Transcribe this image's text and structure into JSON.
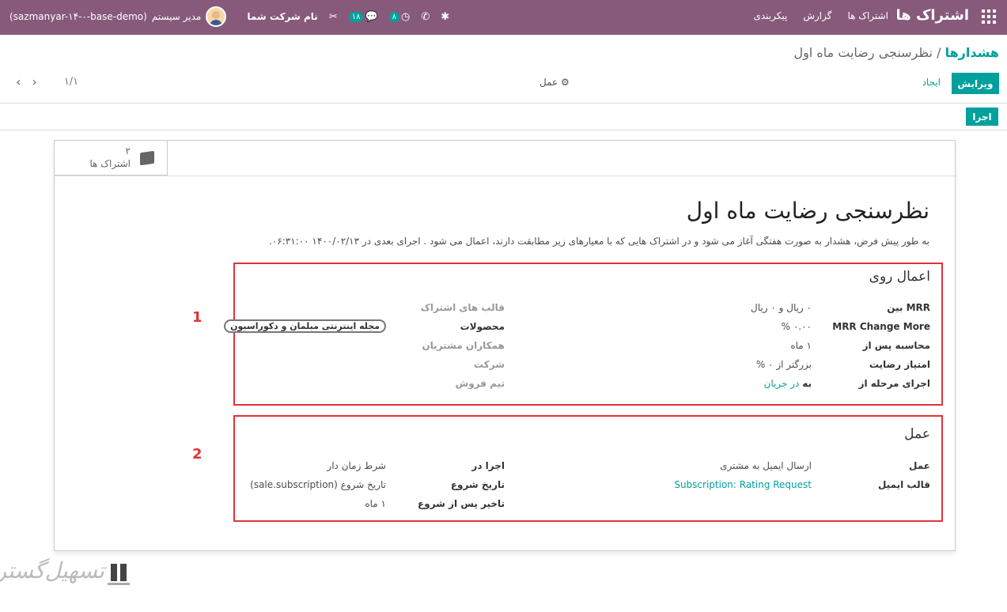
{
  "navbar": {
    "brand": "اشتراک ها",
    "menu": [
      "اشتراک ها",
      "گزارش",
      "پیکربندی"
    ],
    "user_name": "مدیر سیستم",
    "db_name": "(sazmanyar-۱۴-۰-base-demo)",
    "company": "نام شرکت شما",
    "messages_count": "۱۸",
    "activities_count": "۸"
  },
  "breadcrumb": {
    "parent": "هشدارها",
    "separator": "/",
    "current": "نظرسنجی رضایت ماه اول"
  },
  "control": {
    "edit": "ویرایش",
    "create": "ایجاد",
    "action": "عمل",
    "pager": "۱/۱",
    "run": "اجرا"
  },
  "smart_button": {
    "count": "۲",
    "label": "اشتراک ها"
  },
  "form": {
    "title": "نظرسنجی رضایت ماه اول",
    "description": "به طور پیش فرض، هشدار به صورت هفتگی آغاز می شود و در اشتراک هایی که با معیارهای زیر مطابقت دارند، اعمال می شود . اجرای بعدی در ۱۴۰۰/۰۲/۱۳ ۰۶:۳۱:۰۰."
  },
  "apply_on": {
    "title": "اعمال روی",
    "marker": "1",
    "mrr_between_label": "MRR بین",
    "mrr_between_value": "۰ ریال و ۰ ریال",
    "mrr_change_label": "MRR Change More",
    "mrr_change_value": "۰.۰۰ %",
    "compute_after_label": "محاسبه پس از",
    "compute_after_value": "۱ ماه",
    "rating_label": "امتیاز رضایت",
    "rating_value": "بزرگتر از ۰ %",
    "stage_label": "اجرای مرحله از",
    "stage_to": "به",
    "stage_value": "در جریان",
    "templates_label": "قالب های اشتراک",
    "products_label": "محصولات",
    "products_tag": "مجله اینترنتی مبلمان و دکوراسیون",
    "partners_label": "همکاران مشتریان",
    "company_label": "شرکت",
    "team_label": "تیم فروش"
  },
  "action": {
    "title": "عمل",
    "marker": "2",
    "action_label": "عمل",
    "action_value": "ارسال ایمیل به مشتری",
    "template_label": "قالب ایمیل",
    "template_value": "Subscription: Rating Request",
    "run_on_label": "اجرا در",
    "run_on_value": "شرط زمان دار",
    "start_date_label": "تاریخ شروع",
    "start_date_value": "تاریخ شروع (sale.subscription)",
    "delay_label": "تاخیر پس از شروع",
    "delay_value": "۱ ماه"
  },
  "watermark": {
    "text": "تسهیل‌گستر"
  }
}
